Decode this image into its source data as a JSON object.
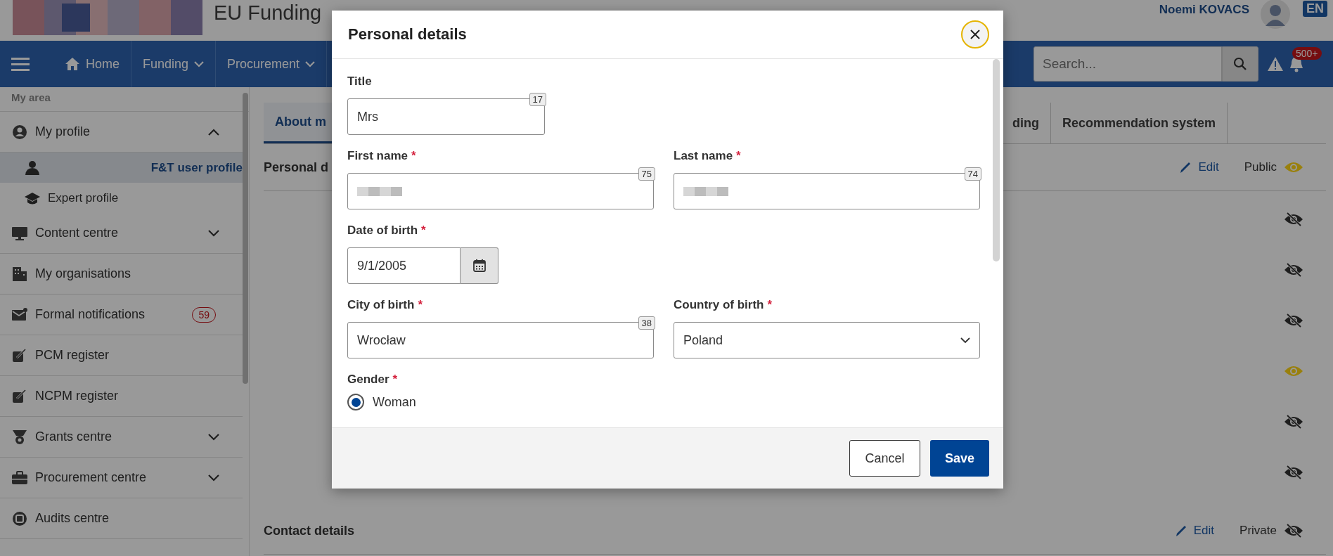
{
  "header": {
    "portal_title": "EU Funding",
    "user_name": "Noemi KOVACS",
    "language": "EN"
  },
  "nav": {
    "items": [
      {
        "label": "Home",
        "kind": "home"
      },
      {
        "label": "Funding",
        "kind": "dropdown"
      },
      {
        "label": "Procurement",
        "kind": "dropdown"
      }
    ],
    "search_placeholder": "Search...",
    "notification_count": "500+"
  },
  "sidebar": {
    "heading": "My area",
    "items": [
      {
        "label": "My profile",
        "expanded": true,
        "children": [
          {
            "label": "F&T user profile",
            "selected": true
          },
          {
            "label": "Expert profile",
            "selected": false
          }
        ]
      },
      {
        "label": "Content centre",
        "expanded": false
      },
      {
        "label": "My organisations"
      },
      {
        "label": "Formal notifications",
        "badge": "59"
      },
      {
        "label": "PCM register"
      },
      {
        "label": "NCPM register"
      },
      {
        "label": "Grants centre",
        "expanded": false
      },
      {
        "label": "Procurement centre",
        "expanded": false
      },
      {
        "label": "Audits centre"
      }
    ]
  },
  "tabs": [
    {
      "label": "About m",
      "selected": true
    },
    {
      "label": "ding",
      "selected": false
    },
    {
      "label": "Recommendation system",
      "selected": false
    }
  ],
  "sections": [
    {
      "title": "Personal d",
      "edit": "Edit",
      "visibility": "Public",
      "public": true,
      "fields": [
        {
          "public": false
        },
        {
          "public": false
        },
        {
          "public": false
        },
        {
          "public": true
        },
        {
          "public": false
        },
        {
          "public": false
        }
      ]
    },
    {
      "title": "Contact details",
      "edit": "Edit",
      "visibility": "Private",
      "public": false
    }
  ],
  "modal": {
    "title": "Personal details",
    "rows": [
      [
        {
          "kind": "text",
          "label": "Title",
          "value": "Mrs",
          "counter": "17"
        }
      ],
      [
        {
          "kind": "redacted",
          "label": "First name",
          "required_mark": "*",
          "counter": "75"
        },
        {
          "kind": "redacted",
          "label": "Last name",
          "required_mark": "*",
          "counter": "74"
        }
      ],
      [
        {
          "kind": "date",
          "label": "Date of birth",
          "required_mark": "*",
          "value": "9/1/2005"
        }
      ],
      [
        {
          "kind": "text",
          "label": "City of birth",
          "required_mark": "*",
          "value": "Wrocław",
          "counter": "38"
        },
        {
          "kind": "select",
          "label": "Country of birth",
          "required_mark": "*",
          "value": "Poland"
        }
      ],
      [
        {
          "kind": "radio",
          "label": "Gender",
          "required_mark": "*",
          "options": [
            {
              "label": "Woman",
              "selected": true
            }
          ]
        }
      ]
    ],
    "buttons": [
      {
        "label": "Cancel",
        "kind": "secondary"
      },
      {
        "label": "Save",
        "kind": "primary"
      }
    ]
  }
}
